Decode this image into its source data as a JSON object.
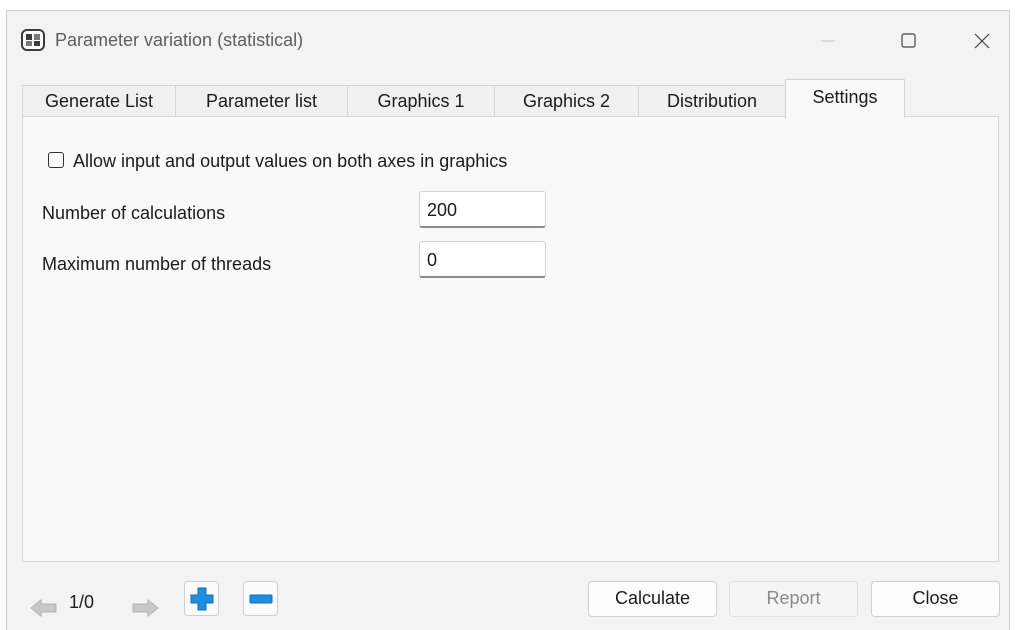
{
  "window": {
    "title": "Parameter variation (statistical)"
  },
  "tabs": [
    {
      "label": "Generate List",
      "active": false
    },
    {
      "label": "Parameter list",
      "active": false
    },
    {
      "label": "Graphics 1",
      "active": false
    },
    {
      "label": "Graphics 2",
      "active": false
    },
    {
      "label": "Distribution",
      "active": false
    },
    {
      "label": "Settings",
      "active": true
    }
  ],
  "settings": {
    "allow_both_axes": {
      "label": "Allow input and output values on both axes in graphics",
      "checked": false
    },
    "num_calculations": {
      "label": "Number of calculations",
      "value": "200"
    },
    "max_threads": {
      "label": "Maximum number of threads",
      "value": "0"
    }
  },
  "footer": {
    "page_count": "1/0",
    "calculate": "Calculate",
    "report": "Report",
    "close": "Close"
  },
  "colors": {
    "accent_blue": "#1e8fe0",
    "disabled_arrow": "#c8c8c8"
  }
}
